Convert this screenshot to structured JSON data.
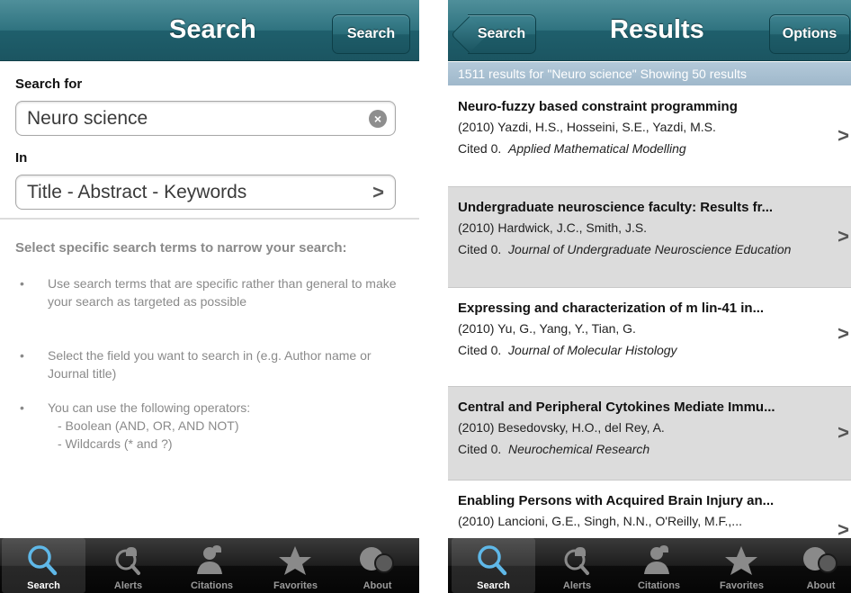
{
  "left": {
    "nav": {
      "title": "Search",
      "search_button": "Search"
    },
    "search_for_label": "Search for",
    "search_value": "Neuro science",
    "in_label": "In",
    "in_value": "Title - Abstract - Keywords",
    "help_title": "Select specific search terms to narrow your search:",
    "bullet_char": "•",
    "tips": [
      "Use search terms that are specific rather than general to make your search as targeted as possible",
      "Select the field you want to search in (e.g. Author name or Journal title)",
      "You can use the following operators:"
    ],
    "operators": [
      "- Boolean (AND, OR, AND NOT)",
      "- Wildcards (* and ?)"
    ]
  },
  "right": {
    "nav": {
      "back_button": "Search",
      "title": "Results",
      "options_button": "Options"
    },
    "results_summary": "1511 results for \"Neuro science\"   Showing 50 results",
    "results": [
      {
        "title": "Neuro-fuzzy based constraint programming",
        "authors": "(2010) Yazdi, H.S., Hosseini, S.E., Yazdi, M.S.",
        "cited": "Cited 0.",
        "journal": "Applied Mathematical Modelling"
      },
      {
        "title": "Undergraduate neuroscience faculty: Results fr...",
        "authors": "(2010) Hardwick, J.C., Smith, J.S.",
        "cited": "Cited 0.",
        "journal": "Journal of Undergraduate Neuroscience Education"
      },
      {
        "title": "Expressing and characterization of m lin-41 in...",
        "authors": "(2010) Yu, G., Yang, Y., Tian, G.",
        "cited": "Cited 0.",
        "journal": "Journal of Molecular Histology"
      },
      {
        "title": "Central and Peripheral Cytokines Mediate Immu...",
        "authors": "(2010) Besedovsky, H.O., del Rey, A.",
        "cited": "Cited 0.",
        "journal": "Neurochemical Research"
      },
      {
        "title": "Enabling Persons with Acquired Brain Injury an...",
        "authors": "(2010) Lancioni, G.E., Singh, N.N., O'Reilly, M.F.,...",
        "cited": "",
        "journal": ""
      }
    ]
  },
  "tabs": [
    {
      "label": "Search",
      "icon": "search-icon"
    },
    {
      "label": "Alerts",
      "icon": "alerts-icon"
    },
    {
      "label": "Citations",
      "icon": "citations-icon"
    },
    {
      "label": "Favorites",
      "icon": "star-icon"
    },
    {
      "label": "About",
      "icon": "about-icon"
    }
  ],
  "colors": {
    "nav": "#2f7380",
    "results_bar": "#a9c0d2",
    "alt_row": "#dcdcdc",
    "muted_text": "#8a8a8a"
  }
}
